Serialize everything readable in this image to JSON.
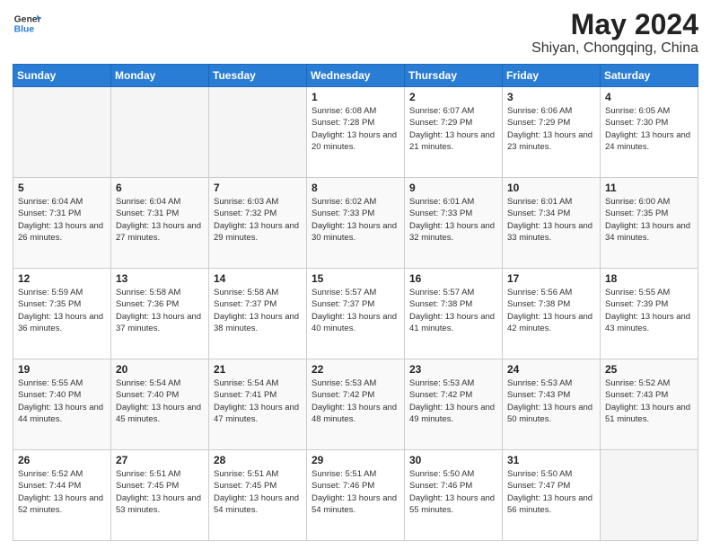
{
  "header": {
    "logo_line1": "General",
    "logo_line2": "Blue",
    "main_title": "May 2024",
    "subtitle": "Shiyan, Chongqing, China"
  },
  "weekdays": [
    "Sunday",
    "Monday",
    "Tuesday",
    "Wednesday",
    "Thursday",
    "Friday",
    "Saturday"
  ],
  "weeks": [
    [
      {
        "day": "",
        "empty": true
      },
      {
        "day": "",
        "empty": true
      },
      {
        "day": "",
        "empty": true
      },
      {
        "day": "1",
        "sunrise": "6:08 AM",
        "sunset": "7:28 PM",
        "daylight": "13 hours and 20 minutes."
      },
      {
        "day": "2",
        "sunrise": "6:07 AM",
        "sunset": "7:29 PM",
        "daylight": "13 hours and 21 minutes."
      },
      {
        "day": "3",
        "sunrise": "6:06 AM",
        "sunset": "7:29 PM",
        "daylight": "13 hours and 23 minutes."
      },
      {
        "day": "4",
        "sunrise": "6:05 AM",
        "sunset": "7:30 PM",
        "daylight": "13 hours and 24 minutes."
      }
    ],
    [
      {
        "day": "5",
        "sunrise": "6:04 AM",
        "sunset": "7:31 PM",
        "daylight": "13 hours and 26 minutes."
      },
      {
        "day": "6",
        "sunrise": "6:04 AM",
        "sunset": "7:31 PM",
        "daylight": "13 hours and 27 minutes."
      },
      {
        "day": "7",
        "sunrise": "6:03 AM",
        "sunset": "7:32 PM",
        "daylight": "13 hours and 29 minutes."
      },
      {
        "day": "8",
        "sunrise": "6:02 AM",
        "sunset": "7:33 PM",
        "daylight": "13 hours and 30 minutes."
      },
      {
        "day": "9",
        "sunrise": "6:01 AM",
        "sunset": "7:33 PM",
        "daylight": "13 hours and 32 minutes."
      },
      {
        "day": "10",
        "sunrise": "6:01 AM",
        "sunset": "7:34 PM",
        "daylight": "13 hours and 33 minutes."
      },
      {
        "day": "11",
        "sunrise": "6:00 AM",
        "sunset": "7:35 PM",
        "daylight": "13 hours and 34 minutes."
      }
    ],
    [
      {
        "day": "12",
        "sunrise": "5:59 AM",
        "sunset": "7:35 PM",
        "daylight": "13 hours and 36 minutes."
      },
      {
        "day": "13",
        "sunrise": "5:58 AM",
        "sunset": "7:36 PM",
        "daylight": "13 hours and 37 minutes."
      },
      {
        "day": "14",
        "sunrise": "5:58 AM",
        "sunset": "7:37 PM",
        "daylight": "13 hours and 38 minutes."
      },
      {
        "day": "15",
        "sunrise": "5:57 AM",
        "sunset": "7:37 PM",
        "daylight": "13 hours and 40 minutes."
      },
      {
        "day": "16",
        "sunrise": "5:57 AM",
        "sunset": "7:38 PM",
        "daylight": "13 hours and 41 minutes."
      },
      {
        "day": "17",
        "sunrise": "5:56 AM",
        "sunset": "7:38 PM",
        "daylight": "13 hours and 42 minutes."
      },
      {
        "day": "18",
        "sunrise": "5:55 AM",
        "sunset": "7:39 PM",
        "daylight": "13 hours and 43 minutes."
      }
    ],
    [
      {
        "day": "19",
        "sunrise": "5:55 AM",
        "sunset": "7:40 PM",
        "daylight": "13 hours and 44 minutes."
      },
      {
        "day": "20",
        "sunrise": "5:54 AM",
        "sunset": "7:40 PM",
        "daylight": "13 hours and 45 minutes."
      },
      {
        "day": "21",
        "sunrise": "5:54 AM",
        "sunset": "7:41 PM",
        "daylight": "13 hours and 47 minutes."
      },
      {
        "day": "22",
        "sunrise": "5:53 AM",
        "sunset": "7:42 PM",
        "daylight": "13 hours and 48 minutes."
      },
      {
        "day": "23",
        "sunrise": "5:53 AM",
        "sunset": "7:42 PM",
        "daylight": "13 hours and 49 minutes."
      },
      {
        "day": "24",
        "sunrise": "5:53 AM",
        "sunset": "7:43 PM",
        "daylight": "13 hours and 50 minutes."
      },
      {
        "day": "25",
        "sunrise": "5:52 AM",
        "sunset": "7:43 PM",
        "daylight": "13 hours and 51 minutes."
      }
    ],
    [
      {
        "day": "26",
        "sunrise": "5:52 AM",
        "sunset": "7:44 PM",
        "daylight": "13 hours and 52 minutes."
      },
      {
        "day": "27",
        "sunrise": "5:51 AM",
        "sunset": "7:45 PM",
        "daylight": "13 hours and 53 minutes."
      },
      {
        "day": "28",
        "sunrise": "5:51 AM",
        "sunset": "7:45 PM",
        "daylight": "13 hours and 54 minutes."
      },
      {
        "day": "29",
        "sunrise": "5:51 AM",
        "sunset": "7:46 PM",
        "daylight": "13 hours and 54 minutes."
      },
      {
        "day": "30",
        "sunrise": "5:50 AM",
        "sunset": "7:46 PM",
        "daylight": "13 hours and 55 minutes."
      },
      {
        "day": "31",
        "sunrise": "5:50 AM",
        "sunset": "7:47 PM",
        "daylight": "13 hours and 56 minutes."
      },
      {
        "day": "",
        "empty": true
      }
    ]
  ]
}
